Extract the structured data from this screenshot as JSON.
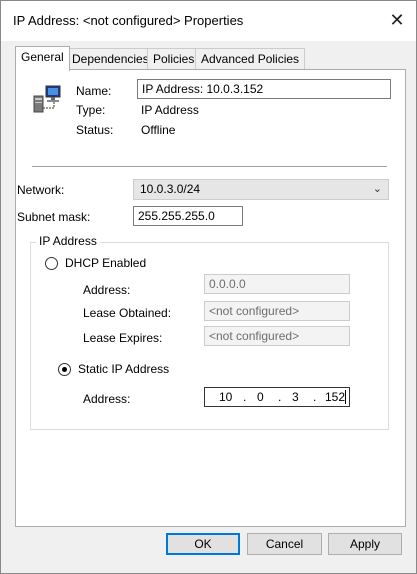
{
  "window": {
    "title": "IP Address: <not configured> Properties",
    "close_glyph": "✕"
  },
  "tabs": [
    {
      "label": "General",
      "active": true
    },
    {
      "label": "Dependencies",
      "active": false
    },
    {
      "label": "Policies",
      "active": false
    },
    {
      "label": "Advanced Policies",
      "active": false
    }
  ],
  "general": {
    "icon": "cluster-resource-icon",
    "name_label": "Name:",
    "name_value": "IP Address: 10.0.3.152",
    "type_label": "Type:",
    "type_value": "IP Address",
    "status_label": "Status:",
    "status_value": "Offline"
  },
  "network": {
    "network_label": "Network:",
    "network_value": "10.0.3.0/24",
    "subnet_label": "Subnet mask:",
    "subnet_value": "255.255.255.0"
  },
  "ip_group": {
    "legend": "IP Address",
    "dhcp": {
      "label": "DHCP Enabled",
      "selected": false,
      "address_label": "Address:",
      "address_value": "0.0.0.0",
      "lease_obtained_label": "Lease Obtained:",
      "lease_obtained_value": "<not configured>",
      "lease_expires_label": "Lease Expires:",
      "lease_expires_value": "<not configured>"
    },
    "static": {
      "label": "Static IP Address",
      "selected": true,
      "address_label": "Address:",
      "octets": [
        "10",
        "0",
        "3",
        "152"
      ],
      "dot": "."
    }
  },
  "buttons": {
    "ok": "OK",
    "cancel": "Cancel",
    "apply": "Apply"
  },
  "colors": {
    "accent": "#0078d7",
    "dialog_bg": "#f0f0f0",
    "panel_bg": "#ffffff"
  }
}
